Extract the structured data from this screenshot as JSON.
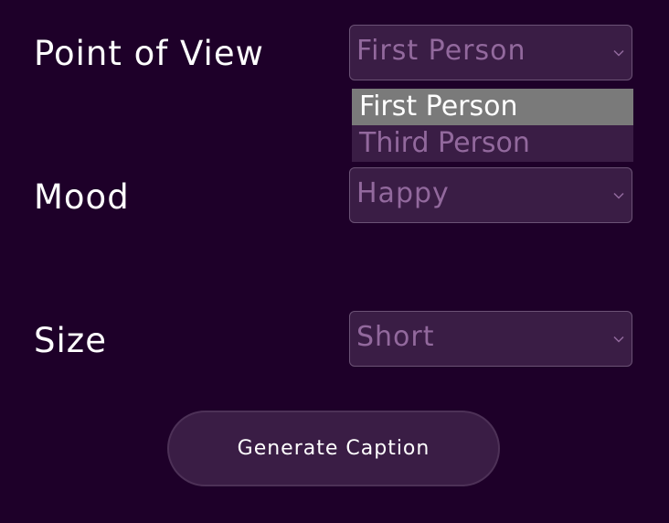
{
  "form": {
    "fields": [
      {
        "label": "Point of View",
        "value": "First Person"
      },
      {
        "label": "Mood",
        "value": "Happy"
      },
      {
        "label": "Size",
        "value": "Short"
      }
    ],
    "dropdown_options": [
      "First Person",
      "Third Person"
    ],
    "dropdown_selected": "First Person",
    "generate_label": "Generate Caption"
  },
  "colors": {
    "background": "#1e0029",
    "control_bg": "#3a1d45",
    "control_text": "#92699d",
    "highlight": "#7a7a7a"
  },
  "icons": {
    "select_chevron": "chevron-down-icon"
  }
}
